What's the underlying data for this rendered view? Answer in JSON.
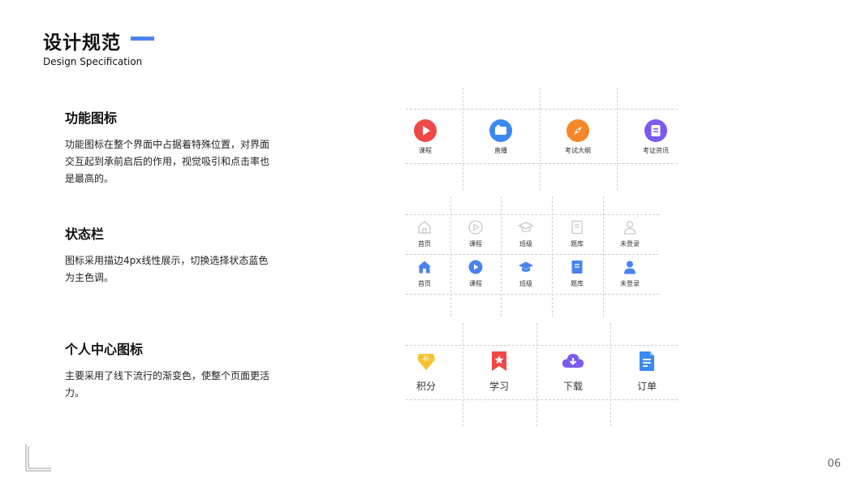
{
  "header": {
    "title": "设计规范",
    "subtitle": "Design Specification"
  },
  "sections": [
    {
      "title": "功能图标",
      "desc": "功能图标在整个界面中占据着特殊位置，对界面交互起到承前启后的作用，视觉吸引和点击率也是最高的。"
    },
    {
      "title": "状态栏",
      "desc": "图标采用描边4px线性展示，切换选择状态蓝色为主色调。"
    },
    {
      "title": "个人中心图标",
      "desc": "主要采用了线下流行的渐变色，使整个页面更活力。"
    }
  ],
  "function_icons": [
    {
      "label": "课程",
      "icon": "play-icon",
      "color": "#f04848"
    },
    {
      "label": "直播",
      "icon": "live-camera-icon",
      "color": "#3a8af2"
    },
    {
      "label": "考试大纲",
      "icon": "compass-icon",
      "color": "#f5862a"
    },
    {
      "label": "考证资讯",
      "icon": "document-icon",
      "color": "#7a5af0"
    }
  ],
  "status_bar": {
    "labels": [
      "首页",
      "课程",
      "班级",
      "题库",
      "未登录"
    ],
    "icons": [
      "home-icon",
      "play-circle-icon",
      "graduation-cap-icon",
      "notebook-icon",
      "user-icon"
    ],
    "inactive_color": "#c8c8c8",
    "active_color": "#4a82ef"
  },
  "personal_icons": [
    {
      "label": "积分",
      "icon": "diamond-badge-icon",
      "badge": "积",
      "color": "#f6c02a"
    },
    {
      "label": "学习",
      "icon": "bookmark-star-icon",
      "color": "#f04848"
    },
    {
      "label": "下载",
      "icon": "cloud-download-icon",
      "color": "#7a5af0"
    },
    {
      "label": "订单",
      "icon": "order-list-icon",
      "color": "#3a8af2"
    }
  ],
  "page_number": "06"
}
